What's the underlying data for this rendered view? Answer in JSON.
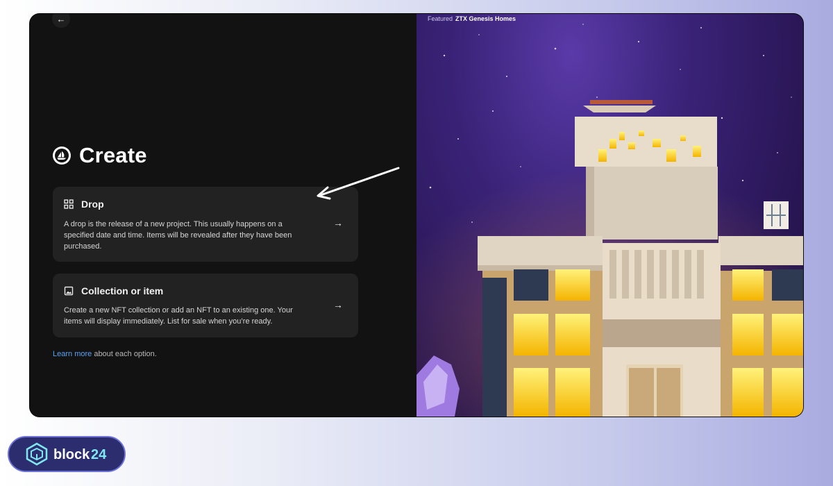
{
  "nav": {
    "back_icon": "arrow-left-icon"
  },
  "header": {
    "title": "Create",
    "logo_icon": "opensea-logo-icon"
  },
  "options": [
    {
      "title": "Drop",
      "icon": "grid-icon",
      "description": "A drop is the release of a new project. This usually happens on a specified date and time. Items will be revealed after they have been purchased.",
      "arrow_icon": "arrow-right-icon"
    },
    {
      "title": "Collection or item",
      "icon": "image-icon",
      "description": "Create a new NFT collection or add an NFT to an existing one. Your items will display immediately. List for sale when you’re ready.",
      "arrow_icon": "arrow-right-icon"
    }
  ],
  "footer": {
    "link_text": "Learn more",
    "rest_text": " about each option."
  },
  "featured": {
    "label": "Featured",
    "name": "ZTX Genesis Homes"
  },
  "watermark": {
    "brand": "block24"
  },
  "colors": {
    "accent_link": "#5aa2f7",
    "card_bg": "#222222",
    "page_bg": "#121212"
  }
}
